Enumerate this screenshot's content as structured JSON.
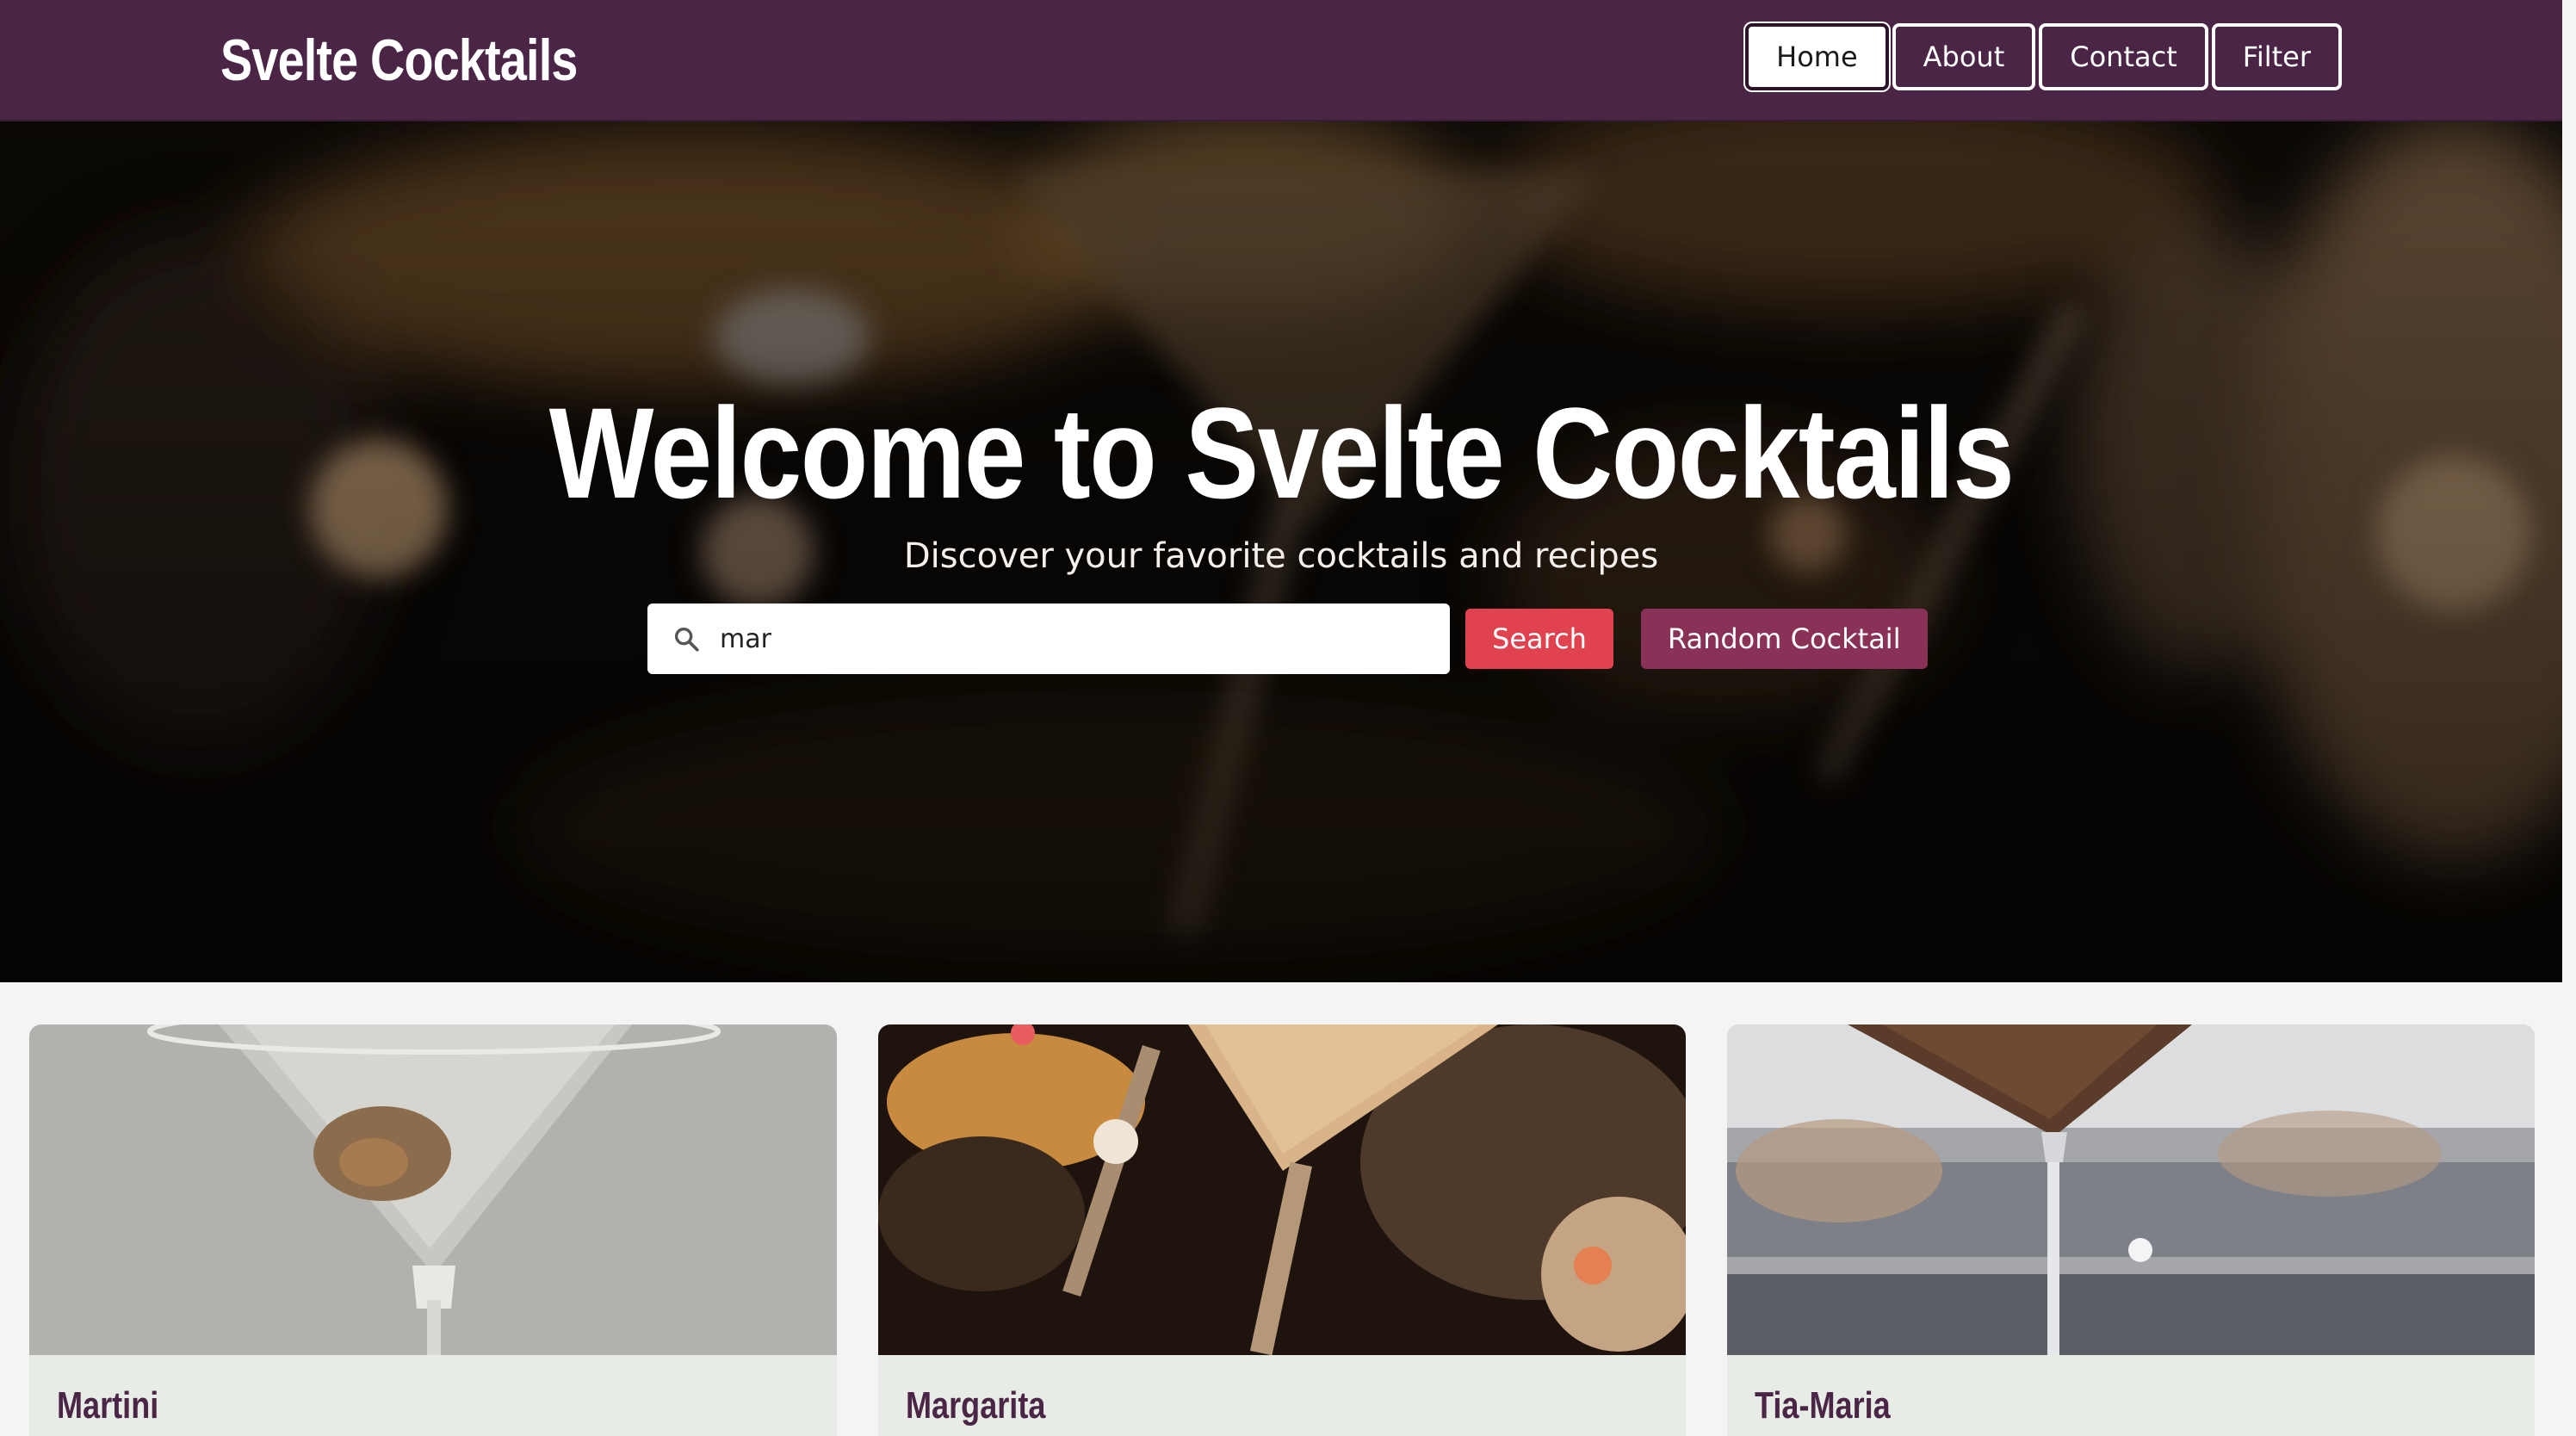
{
  "header": {
    "brand": "Svelte Cocktails",
    "nav": [
      {
        "label": "Home",
        "active": true
      },
      {
        "label": "About",
        "active": false
      },
      {
        "label": "Contact",
        "active": false
      },
      {
        "label": "Filter",
        "active": false
      }
    ]
  },
  "hero": {
    "title": "Welcome to Svelte Cocktails",
    "subtitle": "Discover your favorite cocktails and recipes",
    "search": {
      "value": "mar",
      "icon": "search-icon"
    },
    "search_button": "Search",
    "random_button": "Random Cocktail"
  },
  "cards": [
    {
      "name": "Martini"
    },
    {
      "name": "Margarita"
    },
    {
      "name": "Tia-Maria"
    }
  ],
  "colors": {
    "header_bg": "#4b2546",
    "search_button": "#e0434f",
    "random_button": "#8a3158",
    "card_bg": "#e7ece6",
    "card_title": "#4b2546"
  }
}
